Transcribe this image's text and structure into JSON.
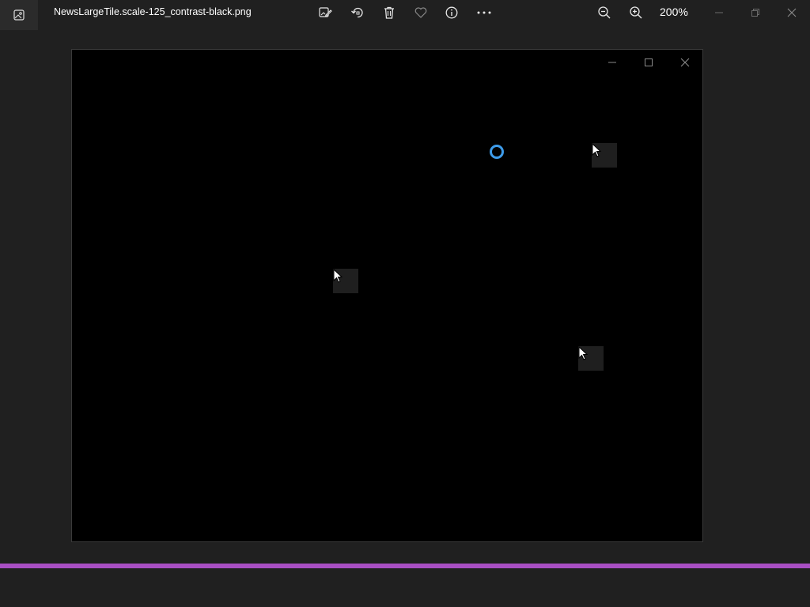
{
  "window": {
    "file_name": "NewsLargeTile.scale-125_contrast-black.png",
    "zoom_level": "200%"
  },
  "toolbar": {
    "buttons": [
      {
        "name": "edit-image",
        "icon": "edit-image-icon"
      },
      {
        "name": "rotate",
        "icon": "rotate-icon"
      },
      {
        "name": "delete",
        "icon": "trash-icon"
      },
      {
        "name": "favorite",
        "icon": "heart-icon"
      },
      {
        "name": "file-info",
        "icon": "info-icon"
      },
      {
        "name": "more",
        "icon": "more-icon"
      },
      {
        "name": "zoom-out",
        "icon": "zoom-out-icon"
      },
      {
        "name": "zoom-in",
        "icon": "zoom-in-icon"
      }
    ]
  },
  "window_controls": [
    "minimize",
    "restore",
    "close"
  ],
  "image_content": {
    "inner_window_controls": [
      "minimize",
      "maximize",
      "close"
    ],
    "loading_indicator": "busy-spinner",
    "cursor_tiles": 3
  },
  "colors": {
    "background": "#202020",
    "image_background": "#000000",
    "spinner": "#3d9be9",
    "accent_strip": "#a94fc4"
  }
}
